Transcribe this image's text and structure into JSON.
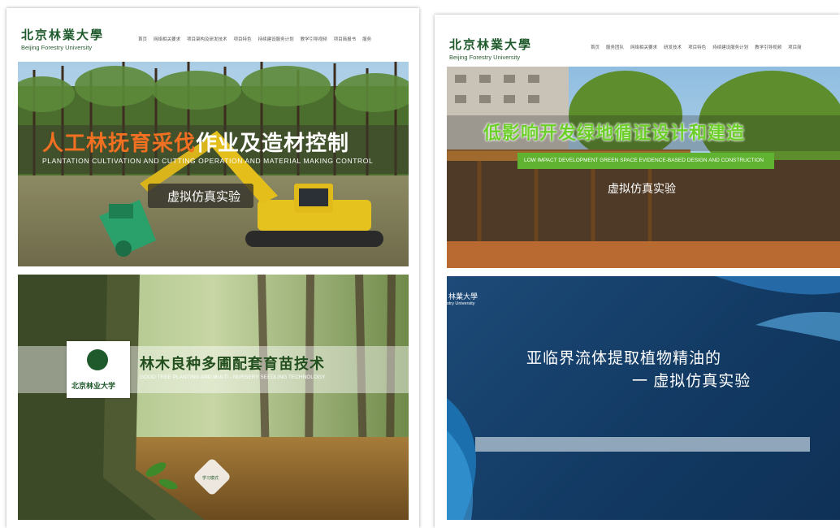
{
  "left": {
    "logo": {
      "cn": "北京林業大學",
      "en": "Beijing Forestry University"
    },
    "nav": [
      "首页",
      "网络相关要求",
      "项目架构及研发技术",
      "项目特色",
      "持续建设服务计划",
      "教学引导视频",
      "项目简报书",
      "服务"
    ],
    "banner1": {
      "title_part1": "人工林抚育采伐",
      "title_part2": "作业及造材控制",
      "subtitle": "PLANTATION CULTIVATION AND CUTTING OPERATION AND MATERIAL MAKING CONTROL",
      "button": "虚拟仿真实验"
    },
    "banner2": {
      "logo_cn": "北京林业大学",
      "title": "林木良种多圃配套育苗技术",
      "subtitle": "GOOD TREE PLANTING AND MULTI - NURSERY SEEDLING TECHNOLOGY",
      "mode": "学习模式"
    }
  },
  "right": {
    "logo": {
      "cn": "北京林業大學",
      "en": "Beijing Forestry University"
    },
    "nav": [
      "首页",
      "服务团队",
      "网络相关要求",
      "研发技术",
      "项目特色",
      "持续建设服务计划",
      "教学引导视频",
      "项目简"
    ],
    "banner1": {
      "title": "低影响开发绿地循证设计和建造",
      "subtitle": "LOW IMPACT DEVELOPMENT GREEN SPACE EVIDENCE-BASED DESIGN AND CONSTRUCTION",
      "button": "虚拟仿真实验"
    },
    "banner2": {
      "logo_cn": "林業大學",
      "logo_en": "stry University",
      "title_line1": "亚临界流体提取植物精油的",
      "title_line2": "一 虚拟仿真实验"
    }
  }
}
